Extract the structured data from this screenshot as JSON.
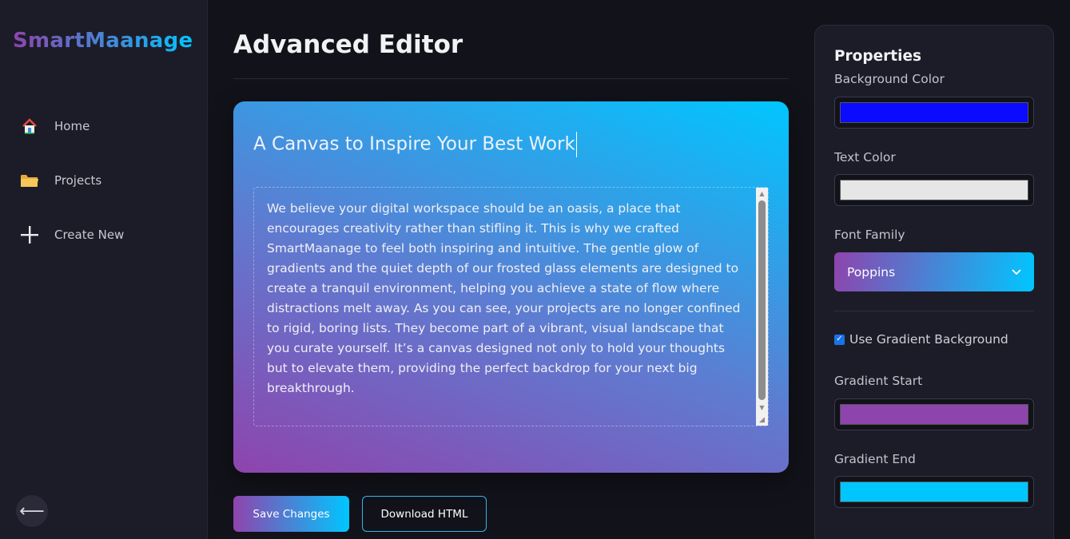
{
  "app": {
    "logo": "SmartMaanage"
  },
  "sidebar": {
    "items": [
      {
        "label": "Home",
        "icon": "house-icon"
      },
      {
        "label": "Projects",
        "icon": "folder-icon"
      },
      {
        "label": "Create New",
        "icon": "plus-icon"
      }
    ],
    "collapse_icon": "arrow-left-icon",
    "collapse_glyph": "⟵"
  },
  "main": {
    "title": "Advanced Editor",
    "canvas": {
      "title": "A Canvas to Inspire Your Best Work",
      "body": "We believe your digital workspace should be an oasis, a place that encourages creativity rather than stifling it. This is why we crafted SmartMaanage to feel both inspiring and intuitive. The gentle glow of gradients and the quiet depth of our frosted glass elements are designed to create a tranquil environment, helping you achieve a state of flow where distractions melt away. As you can see, your projects are no longer confined to rigid, boring lists. They become part of a vibrant, visual landscape that you curate yourself. It’s a canvas designed not only to hold your thoughts but to elevate them, providing the perfect backdrop for your next big breakthrough."
    },
    "buttons": {
      "save": "Save Changes",
      "download": "Download HTML"
    }
  },
  "properties": {
    "title": "Properties",
    "background_color": {
      "label": "Background Color",
      "value": "#0b0bff"
    },
    "text_color": {
      "label": "Text Color",
      "value": "#e6e6e6"
    },
    "font_family": {
      "label": "Font Family",
      "value": "Poppins"
    },
    "use_gradient": {
      "label": "Use Gradient Background",
      "checked": true
    },
    "gradient_start": {
      "label": "Gradient Start",
      "value": "#8e44ad"
    },
    "gradient_end": {
      "label": "Gradient End",
      "value": "#00c6ff"
    }
  },
  "colors": {
    "accent_start": "#8e44ad",
    "accent_end": "#00c6ff",
    "background": "#12121a",
    "sidebar": "#1c1c28"
  }
}
